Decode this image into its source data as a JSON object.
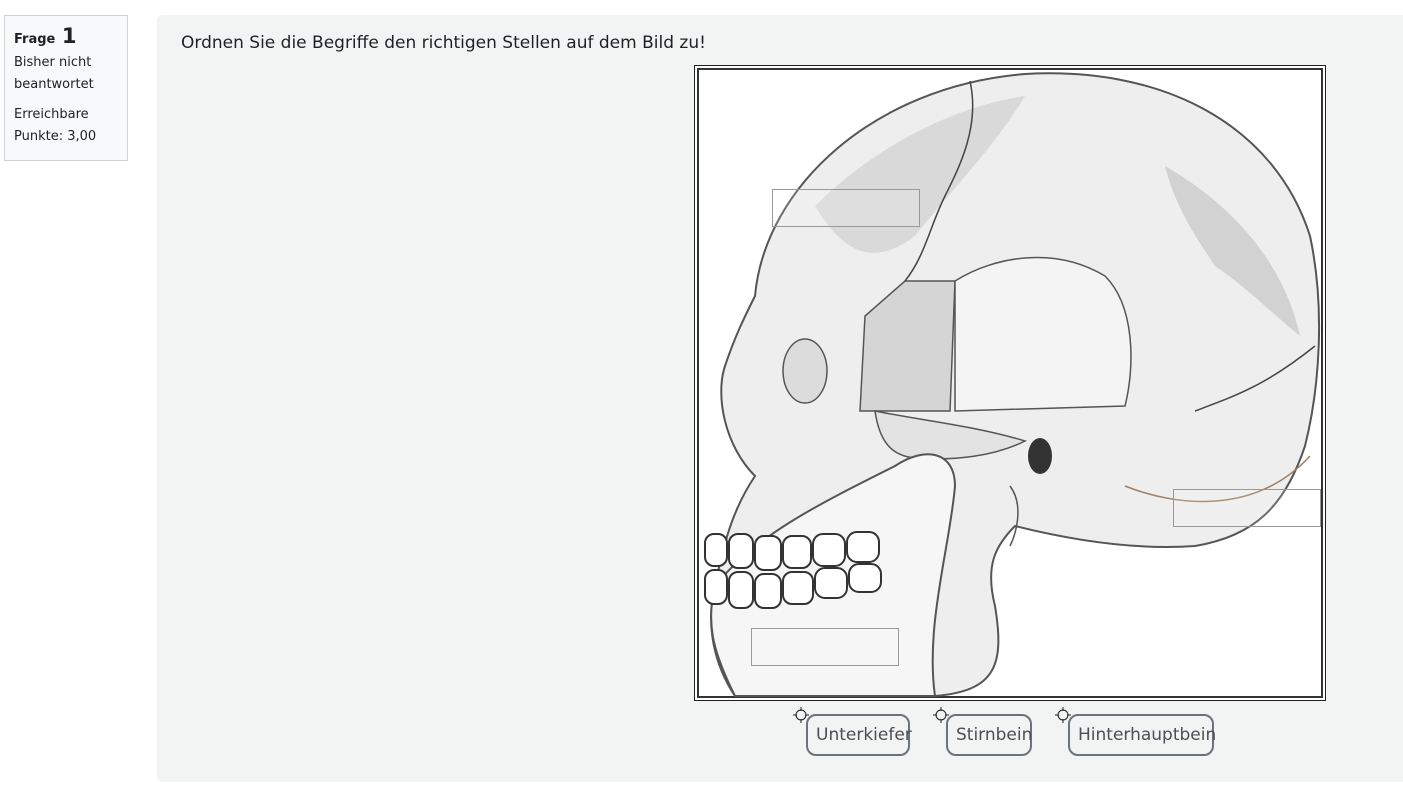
{
  "question_info": {
    "label": "Frage",
    "number": "1",
    "state": "Bisher nicht beantwortet",
    "grade": "Erreichbare Punkte: 3,00"
  },
  "question": {
    "prompt": "Ordnen Sie die Begriffe den richtigen Stellen auf dem Bild zu!",
    "image_subject": "skull lateral view illustration"
  },
  "drag_items": [
    {
      "label": "Unterkiefer"
    },
    {
      "label": "Stirnbein"
    },
    {
      "label": "Hinterhauptbein"
    }
  ],
  "icons": {
    "move": "move-crosshair-icon"
  },
  "colors": {
    "content_bg": "#f2f3f3",
    "info_bg": "#f8f9fa",
    "item_border": "#6a737b"
  }
}
